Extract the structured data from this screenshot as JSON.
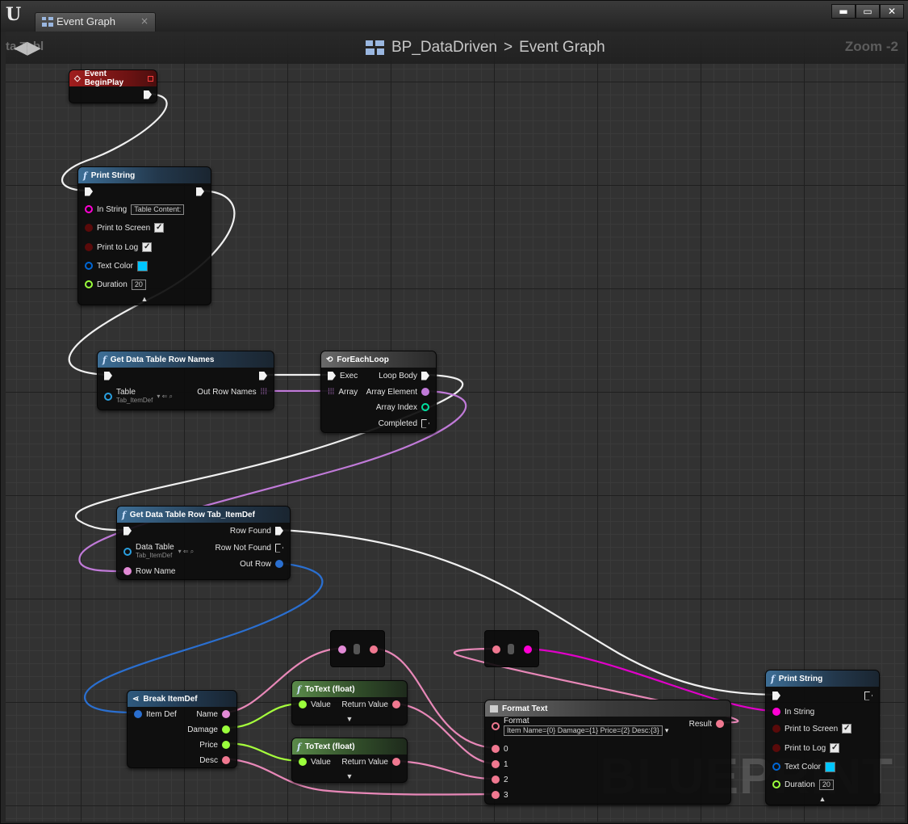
{
  "window": {
    "tab_title": "Event Graph",
    "tab_close": "×",
    "buttons": {
      "minimize": "▬",
      "maximize": "▭",
      "close": "✕"
    }
  },
  "graph_header": {
    "nav_ghost": "ta Tabl",
    "nav_arrows": "◀▶",
    "breadcrumb": {
      "blueprint": "BP_DataDriven",
      "separator": ">",
      "graph": "Event Graph"
    },
    "zoom": "Zoom -2"
  },
  "watermark": "BLUEPRINT",
  "colors": {
    "exec": "#ffffff",
    "string": "#ff00d4",
    "name": "#e28ad6",
    "object": "#0067d6",
    "float": "#9bff3c",
    "int": "#00e0a0",
    "text": "#f07890"
  },
  "nodes": {
    "event_beginplay": {
      "title": "Event BeginPlay"
    },
    "print_string_1": {
      "title": "Print String",
      "in_string_label": "In String",
      "in_string_value": "Table Content:",
      "print_screen_label": "Print to Screen",
      "print_log_label": "Print to Log",
      "text_color_label": "Text Color",
      "duration_label": "Duration",
      "duration_value": "20",
      "checkmark": "✓",
      "collapse": "▲"
    },
    "get_row_names": {
      "title": "Get Data Table Row Names",
      "table_label": "Table",
      "table_value": "Tab_ItemDef",
      "out_label": "Out Row Names"
    },
    "foreach": {
      "title": "ForEachLoop",
      "exec_label": "Exec",
      "array_label": "Array",
      "loop_body": "Loop Body",
      "array_element": "Array Element",
      "array_index": "Array Index",
      "completed": "Completed"
    },
    "get_row": {
      "title": "Get Data Table Row Tab_ItemDef",
      "data_table_label": "Data Table",
      "data_table_value": "Tab_ItemDef",
      "row_name_label": "Row Name",
      "row_found": "Row Found",
      "row_not_found": "Row Not Found",
      "out_row": "Out Row"
    },
    "break_item": {
      "title": "Break ItemDef",
      "item_def": "Item Def",
      "name": "Name",
      "damage": "Damage",
      "price": "Price",
      "desc": "Desc"
    },
    "totext_1": {
      "title": "ToText (float)",
      "value": "Value",
      "return_value": "Return Value",
      "collapse": "▼"
    },
    "totext_2": {
      "title": "ToText (float)",
      "value": "Value",
      "return_value": "Return Value",
      "collapse": "▼"
    },
    "format_text": {
      "title": "Format Text",
      "format_label": "Format",
      "format_value": "Item Name={0} Damage={1} Price={2} Desc:{3}",
      "result": "Result",
      "args": [
        "0",
        "1",
        "2",
        "3"
      ]
    },
    "print_string_2": {
      "title": "Print String",
      "in_string_label": "In String",
      "print_screen_label": "Print to Screen",
      "print_log_label": "Print to Log",
      "text_color_label": "Text Color",
      "duration_label": "Duration",
      "duration_value": "20",
      "checkmark": "✓",
      "collapse": "▲"
    }
  }
}
